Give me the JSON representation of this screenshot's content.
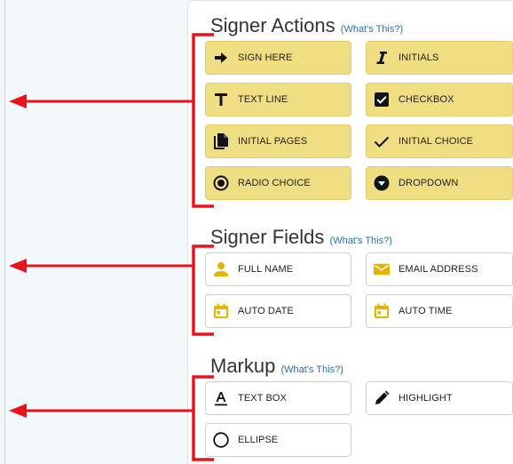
{
  "colors": {
    "accent": "#f0de82",
    "link": "#2a6fb0",
    "annotation": "#e8141b",
    "field_icon": "#e6b300"
  },
  "signer_actions": {
    "title": "Signer Actions",
    "paren_open": "(",
    "help_link": "What's This?",
    "paren_close": ")",
    "buttons": [
      {
        "label": "SIGN HERE",
        "icon": "arrow-right-icon"
      },
      {
        "label": "INITIALS",
        "icon": "italic-i-icon"
      },
      {
        "label": "TEXT LINE",
        "icon": "text-t-icon"
      },
      {
        "label": "CHECKBOX",
        "icon": "checkbox-icon"
      },
      {
        "label": "INITIAL PAGES",
        "icon": "pages-icon"
      },
      {
        "label": "INITIAL CHOICE",
        "icon": "checkmark-icon"
      },
      {
        "label": "RADIO CHOICE",
        "icon": "radio-icon"
      },
      {
        "label": "DROPDOWN",
        "icon": "dropdown-icon"
      }
    ]
  },
  "signer_fields": {
    "title": "Signer Fields",
    "paren_open": "(",
    "help_link": "What's This?",
    "paren_close": ")",
    "buttons": [
      {
        "label": "FULL NAME",
        "icon": "person-icon"
      },
      {
        "label": "EMAIL ADDRESS",
        "icon": "envelope-icon"
      },
      {
        "label": "AUTO DATE",
        "icon": "calendar-icon"
      },
      {
        "label": "AUTO TIME",
        "icon": "calendar-icon"
      }
    ]
  },
  "markup": {
    "title": "Markup",
    "paren_open": "(",
    "help_link": "What's This?",
    "paren_close": ")",
    "buttons": [
      {
        "label": "TEXT BOX",
        "icon": "text-box-icon"
      },
      {
        "label": "HIGHLIGHT",
        "icon": "pen-icon"
      },
      {
        "label": "ELLIPSE",
        "icon": "ellipse-icon"
      }
    ]
  }
}
